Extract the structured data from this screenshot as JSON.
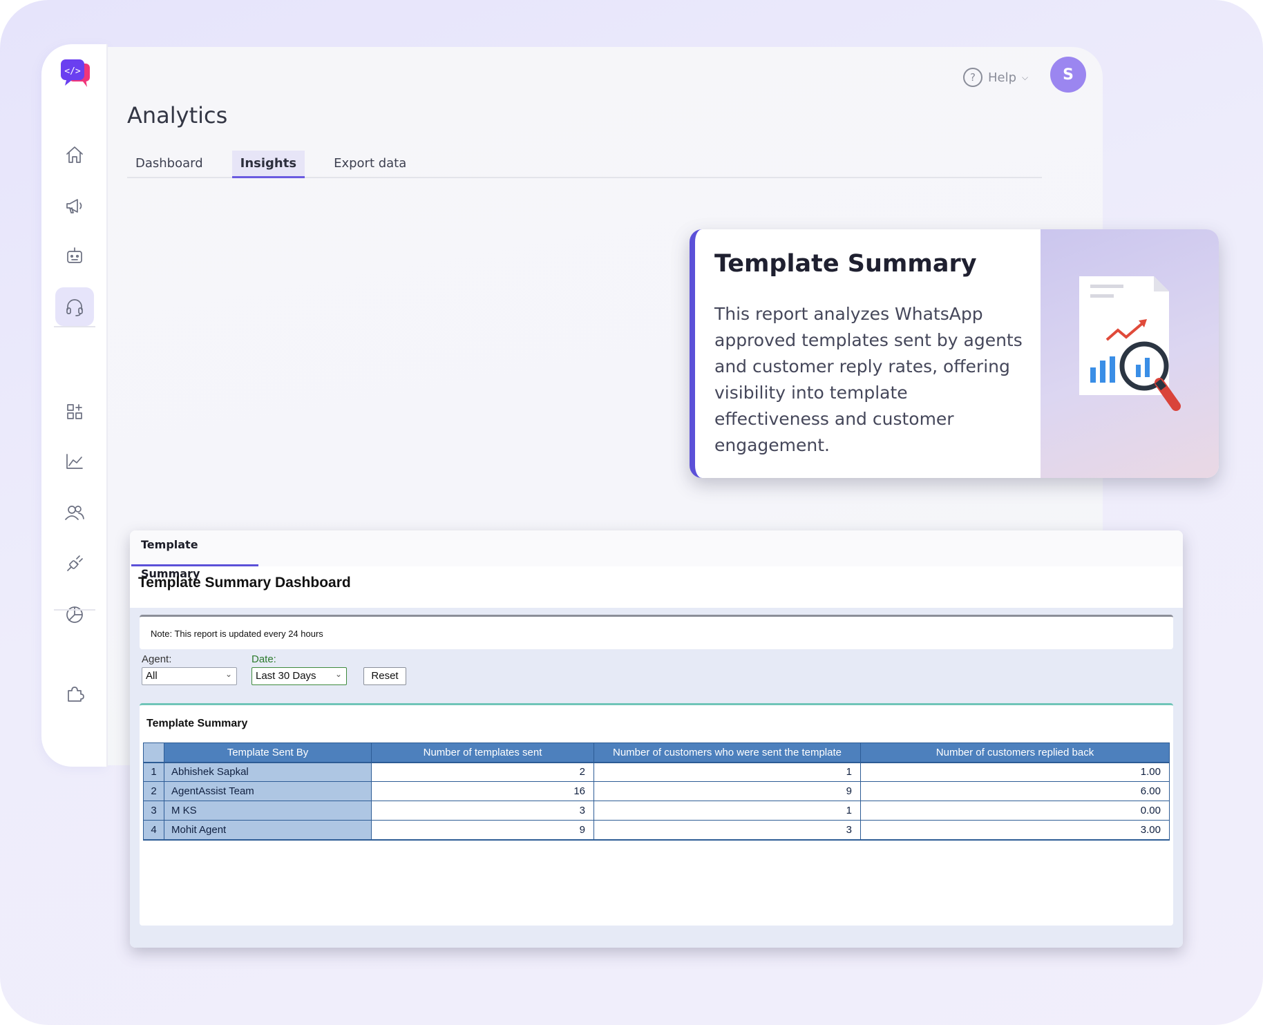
{
  "app": {
    "page_title": "Analytics",
    "help_label": "Help",
    "avatar_initial": "S",
    "brand_colors": {
      "accent": "#5b50d8",
      "avatar": "#9b86f0",
      "table_header": "#4d80bd"
    }
  },
  "sidebar": {
    "items": [
      {
        "name": "home",
        "icon": "home-icon",
        "active": false
      },
      {
        "name": "campaigns",
        "icon": "megaphone-icon",
        "active": false
      },
      {
        "name": "bots",
        "icon": "robot-icon",
        "active": false
      },
      {
        "name": "support",
        "icon": "headset-icon",
        "active": true
      },
      {
        "name": "apps",
        "icon": "grid-plus-icon",
        "active": false
      },
      {
        "name": "analytics",
        "icon": "line-chart-icon",
        "active": false
      },
      {
        "name": "contacts",
        "icon": "users-icon",
        "active": false
      },
      {
        "name": "integrations",
        "icon": "plug-icon",
        "active": false
      },
      {
        "name": "reports",
        "icon": "pie-chart-icon",
        "active": false
      },
      {
        "name": "extensions",
        "icon": "puzzle-icon",
        "active": false
      }
    ]
  },
  "tabs": [
    {
      "label": "Dashboard",
      "active": false
    },
    {
      "label": "Insights",
      "active": true
    },
    {
      "label": "Export data",
      "active": false
    }
  ],
  "info_card": {
    "title": "Template Summary",
    "description": "This report analyzes WhatsApp approved templates sent by agents and customer reply rates, offering visibility into template effectiveness and customer engagement."
  },
  "report": {
    "tab_label": "Template Summary",
    "dashboard_title": "Template Summary Dashboard",
    "note": "Note: This report is updated every 24 hours",
    "filters": {
      "agent_label": "Agent:",
      "agent_value": "All",
      "date_label": "Date:",
      "date_value": "Last 30 Days",
      "reset_label": "Reset"
    },
    "summary_title": "Template Summary",
    "columns": [
      "Template Sent By",
      "Number of templates sent",
      "Number of customers who were sent the template",
      "Number of customers replied back"
    ],
    "rows": [
      {
        "idx": "1",
        "name": "Abhishek Sapkal",
        "sent": "2",
        "customers": "1",
        "replied": "1.00"
      },
      {
        "idx": "2",
        "name": "AgentAssist Team",
        "sent": "16",
        "customers": "9",
        "replied": "6.00"
      },
      {
        "idx": "3",
        "name": "M KS",
        "sent": "3",
        "customers": "1",
        "replied": "0.00"
      },
      {
        "idx": "4",
        "name": "Mohit Agent",
        "sent": "9",
        "customers": "3",
        "replied": "3.00"
      }
    ]
  }
}
